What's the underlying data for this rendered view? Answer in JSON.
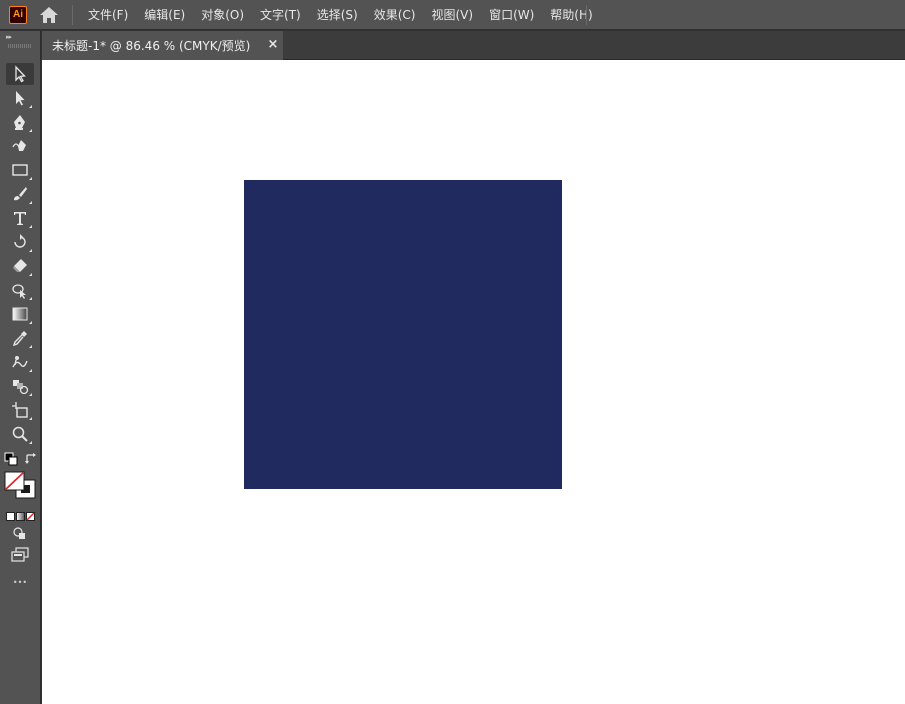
{
  "app": {
    "logo_text": "Ai",
    "logo_color": "#ff9a00"
  },
  "menu": {
    "items": [
      {
        "label": "文件(F)"
      },
      {
        "label": "编辑(E)"
      },
      {
        "label": "对象(O)"
      },
      {
        "label": "文字(T)"
      },
      {
        "label": "选择(S)"
      },
      {
        "label": "效果(C)"
      },
      {
        "label": "视图(V)"
      },
      {
        "label": "窗口(W)"
      },
      {
        "label": "帮助(H)"
      }
    ]
  },
  "document": {
    "tab_title": "未标题-1* @ 86.46 % (CMYK/预览)",
    "close_glyph": "×",
    "shape_fill": "#202a5e"
  },
  "toolbar": {
    "tools": [
      {
        "icon": "selection-tool-icon"
      },
      {
        "icon": "direct-selection-tool-icon"
      },
      {
        "icon": "pen-tool-icon"
      },
      {
        "icon": "curvature-tool-icon"
      },
      {
        "icon": "rectangle-tool-icon"
      },
      {
        "icon": "paintbrush-tool-icon"
      },
      {
        "icon": "type-tool-icon"
      },
      {
        "icon": "rotate-tool-icon"
      },
      {
        "icon": "eraser-tool-icon"
      },
      {
        "icon": "shape-builder-tool-icon"
      },
      {
        "icon": "gradient-tool-icon"
      },
      {
        "icon": "eyedropper-tool-icon"
      },
      {
        "icon": "puppet-warp-tool-icon"
      },
      {
        "icon": "blend-tool-icon"
      },
      {
        "icon": "artboard-tool-icon"
      },
      {
        "icon": "zoom-tool-icon"
      }
    ],
    "more_glyph": "•••"
  }
}
